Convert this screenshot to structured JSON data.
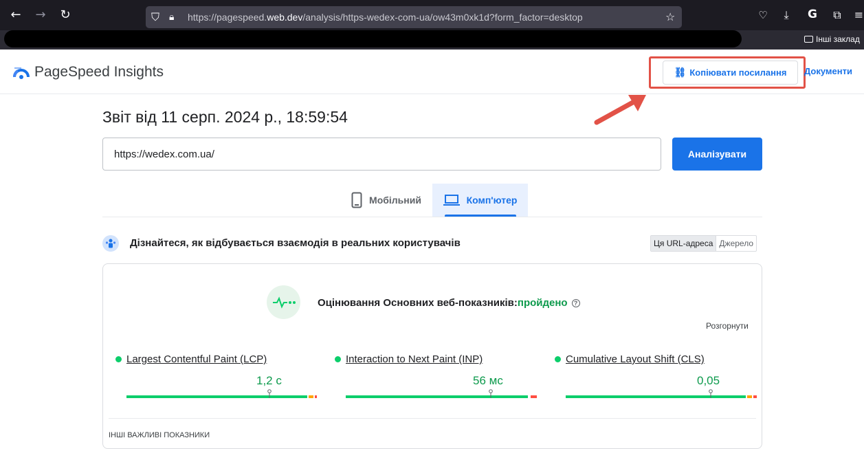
{
  "browser": {
    "url_prefix": "https://pagespeed.",
    "url_domain": "web.dev",
    "url_suffix": "/analysis/https-wedex-com-ua/ow43m0xk1d?form_factor=desktop",
    "bookmark_other": "Інші заклад"
  },
  "header": {
    "brand": "PageSpeed Insights",
    "copy_link": "Копіювати посилання",
    "docs": "Документи"
  },
  "report": {
    "title": "Звіт від 11 серп. 2024 р., 18:59:54",
    "url_value": "https://wedex.com.ua/",
    "analyze": "Аналізувати"
  },
  "tabs": [
    {
      "label": "Мобільний",
      "active": false
    },
    {
      "label": "Комп'ютер",
      "active": true
    }
  ],
  "crux": {
    "title": "Дізнайтеся, як відбувається взаємодія в реальних користувачів",
    "toggle_url": "Ця URL-адреса",
    "toggle_origin": "Джерело"
  },
  "cwv": {
    "label": "Оцінювання Основних веб-показників:",
    "status": "пройдено",
    "expand": "Розгорнути"
  },
  "metrics": [
    {
      "name": "Largest Contentful Paint (LCP)",
      "value": "1,2 с",
      "marker_fraction": 0.75
    },
    {
      "name": "Interaction to Next Paint (INP)",
      "value": "56 мс",
      "marker_fraction": 0.76
    },
    {
      "name": "Cumulative Layout Shift (CLS)",
      "value": "0,05",
      "marker_fraction": 0.76
    }
  ],
  "other_metrics": "ІНШІ ВАЖЛИВІ ПОКАЗНИКИ",
  "colors": {
    "accent": "#1a73e8",
    "good": "#0cce6b",
    "pass_text": "#0d9a4c",
    "highlight": "#e25247"
  }
}
